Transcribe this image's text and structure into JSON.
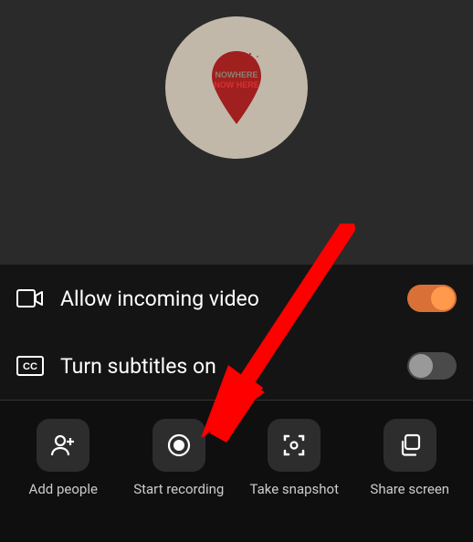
{
  "avatar": {
    "text_top": "NOWHERE",
    "text_bottom": "NOW HERE"
  },
  "settings": {
    "incoming_video": {
      "label": "Allow incoming video",
      "enabled": true
    },
    "subtitles": {
      "label": "Turn subtitles on",
      "enabled": false
    }
  },
  "toolbar": {
    "add_people": {
      "label": "Add people"
    },
    "start_recording": {
      "label": "Start recording"
    },
    "take_snapshot": {
      "label": "Take snapshot"
    },
    "share_screen": {
      "label": "Share screen"
    }
  }
}
